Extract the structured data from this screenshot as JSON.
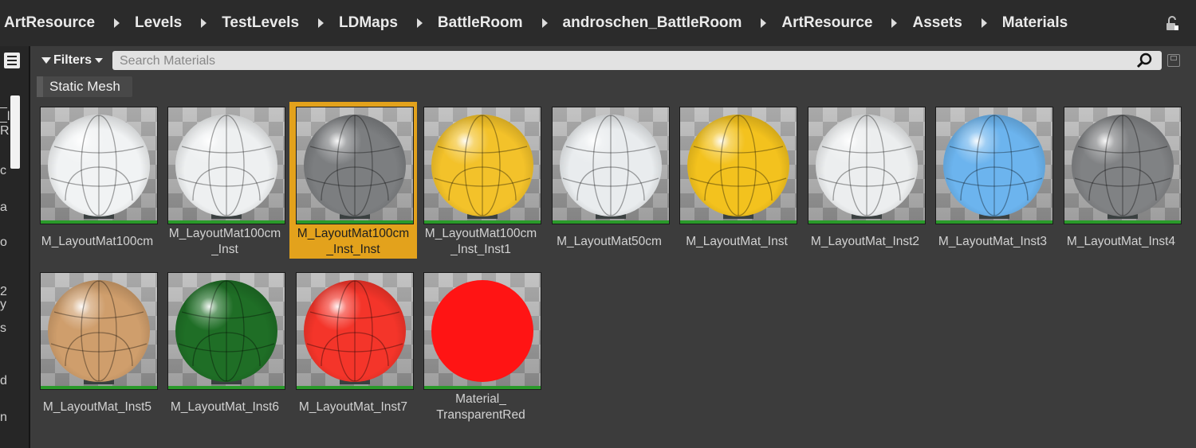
{
  "breadcrumb": [
    "ArtResource",
    "Levels",
    "TestLevels",
    "LDMaps",
    "BattleRoom",
    "androschen_BattleRoom",
    "ArtResource",
    "Assets",
    "Materials"
  ],
  "left_fragments": [
    "_",
    "_l",
    "R",
    "c",
    "a",
    "o",
    "2",
    "y",
    "s",
    "d",
    "n"
  ],
  "toolbar": {
    "filters_label": "Filters"
  },
  "search": {
    "placeholder": "Search Materials",
    "value": ""
  },
  "filter_chip": "Static Mesh",
  "selected_index": 2,
  "materials": [
    {
      "line1": "M_LayoutMat100cm",
      "line2": "",
      "color": "#f1f3f4"
    },
    {
      "line1": "M_LayoutMat100cm",
      "line2": "_Inst",
      "color": "#eef0f1"
    },
    {
      "line1": "M_LayoutMat100cm",
      "line2": "_Inst_Inst",
      "color": "#7c7e80"
    },
    {
      "line1": "M_LayoutMat100cm",
      "line2": "_Inst_Inst1",
      "color": "#f3c22a"
    },
    {
      "line1": "M_LayoutMat50cm",
      "line2": "",
      "color": "#e9ecee"
    },
    {
      "line1": "M_LayoutMat_Inst",
      "line2": "",
      "color": "#f3c21e"
    },
    {
      "line1": "M_LayoutMat_Inst2",
      "line2": "",
      "color": "#eceeef"
    },
    {
      "line1": "M_LayoutMat_Inst3",
      "line2": "",
      "color": "#6cb4ee"
    },
    {
      "line1": "M_LayoutMat_Inst4",
      "line2": "",
      "color": "#808284"
    },
    {
      "line1": "M_LayoutMat_Inst5",
      "line2": "",
      "color": "#cf9e6c"
    },
    {
      "line1": "M_LayoutMat_Inst6",
      "line2": "",
      "color": "#1f6e26"
    },
    {
      "line1": "M_LayoutMat_Inst7",
      "line2": "",
      "color": "#f4352a"
    },
    {
      "line1": "Material_",
      "line2": "TransparentRed",
      "color": "#ff1414"
    }
  ]
}
